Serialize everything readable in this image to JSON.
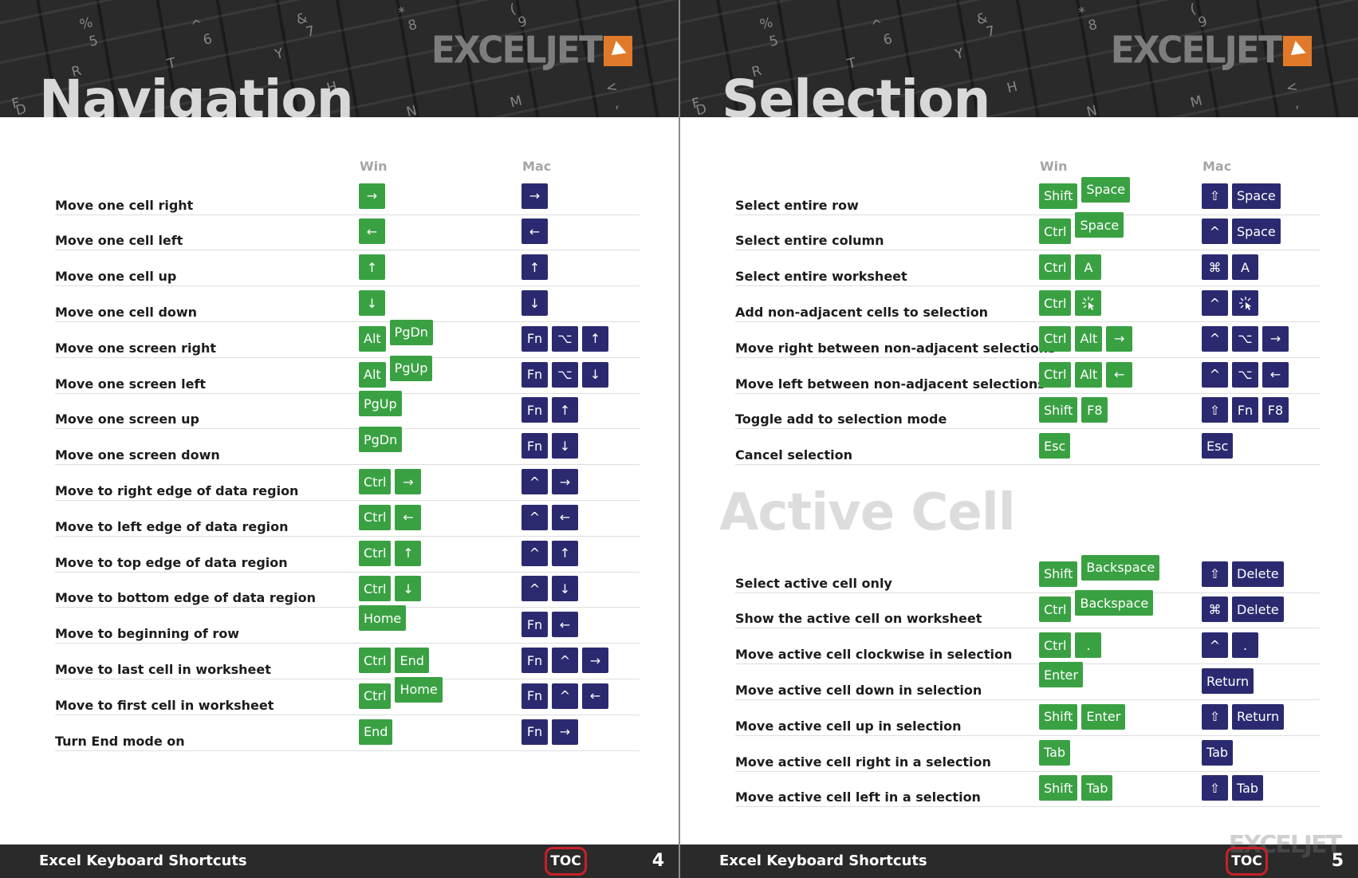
{
  "logo": "EXCELJET",
  "keycaps": [
    "%",
    "5",
    "^",
    "6",
    "&",
    "7",
    "*",
    "8",
    "(",
    "9",
    "T",
    "Y",
    "R",
    "F",
    "H",
    "D",
    "N",
    "M",
    "<",
    ","
  ],
  "columns": {
    "win": "Win",
    "mac": "Mac"
  },
  "left": {
    "title": "Navigation",
    "rows": [
      {
        "label": "Move one cell right",
        "win": [
          "→"
        ],
        "mac": [
          "→"
        ]
      },
      {
        "label": "Move one cell left",
        "win": [
          "←"
        ],
        "mac": [
          "←"
        ]
      },
      {
        "label": "Move one cell up",
        "win": [
          "↑"
        ],
        "mac": [
          "↑"
        ]
      },
      {
        "label": "Move one cell down",
        "win": [
          "↓"
        ],
        "mac": [
          "↓"
        ]
      },
      {
        "label": "Move one screen right",
        "win": [
          "Alt",
          "PgDn"
        ],
        "mac": [
          "Fn",
          "⌥",
          "↑"
        ]
      },
      {
        "label": "Move one screen left",
        "win": [
          "Alt",
          "PgUp"
        ],
        "mac": [
          "Fn",
          "⌥",
          "↓"
        ]
      },
      {
        "label": "Move one screen up",
        "win": [
          "PgUp"
        ],
        "mac": [
          "Fn",
          "↑"
        ]
      },
      {
        "label": "Move one screen down",
        "win": [
          "PgDn"
        ],
        "mac": [
          "Fn",
          "↓"
        ]
      },
      {
        "label": "Move to right edge of data region",
        "win": [
          "Ctrl",
          "→"
        ],
        "mac": [
          "^",
          "→"
        ]
      },
      {
        "label": "Move to left edge of data region",
        "win": [
          "Ctrl",
          "←"
        ],
        "mac": [
          "^",
          "←"
        ]
      },
      {
        "label": "Move to top edge of data region",
        "win": [
          "Ctrl",
          "↑"
        ],
        "mac": [
          "^",
          "↑"
        ]
      },
      {
        "label": "Move to bottom edge of data region",
        "win": [
          "Ctrl",
          "↓"
        ],
        "mac": [
          "^",
          "↓"
        ]
      },
      {
        "label": "Move to beginning of row",
        "win": [
          "Home"
        ],
        "mac": [
          "Fn",
          "←"
        ]
      },
      {
        "label": "Move to last cell in worksheet",
        "win": [
          "Ctrl",
          "End"
        ],
        "mac": [
          "Fn",
          "^",
          "→"
        ]
      },
      {
        "label": "Move to first cell in worksheet",
        "win": [
          "Ctrl",
          "Home"
        ],
        "mac": [
          "Fn",
          "^",
          "←"
        ]
      },
      {
        "label": "Turn End mode on",
        "win": [
          "End"
        ],
        "mac": [
          "Fn",
          "→"
        ]
      }
    ],
    "footer": {
      "title": "Excel Keyboard Shortcuts",
      "toc": "TOC",
      "page": "4"
    }
  },
  "right": {
    "title": "Selection",
    "rows": [
      {
        "label": "Select entire row",
        "win": [
          "Shift",
          "Space"
        ],
        "mac": [
          "⇧",
          "Space"
        ]
      },
      {
        "label": "Select entire column",
        "win": [
          "Ctrl",
          "Space"
        ],
        "mac": [
          "^",
          "Space"
        ]
      },
      {
        "label": "Select entire worksheet",
        "win": [
          "Ctrl",
          "A"
        ],
        "mac": [
          "⌘",
          "A"
        ]
      },
      {
        "label": "Add non-adjacent cells to selection",
        "win": [
          "Ctrl",
          "click"
        ],
        "mac": [
          "^",
          "click"
        ]
      },
      {
        "label": "Move right between non-adjacent selections",
        "win": [
          "Ctrl",
          "Alt",
          "→"
        ],
        "mac": [
          "^",
          "⌥",
          "→"
        ]
      },
      {
        "label": "Move left between non-adjacent selections",
        "win": [
          "Ctrl",
          "Alt",
          "←"
        ],
        "mac": [
          "^",
          "⌥",
          "←"
        ]
      },
      {
        "label": "Toggle add to selection mode",
        "win": [
          "Shift",
          "F8"
        ],
        "mac": [
          "⇧",
          "Fn",
          "F8"
        ]
      },
      {
        "label": "Cancel selection",
        "win": [
          "Esc"
        ],
        "mac": [
          "Esc"
        ]
      }
    ],
    "section2": "Active Cell",
    "rows2": [
      {
        "label": "Select active cell only",
        "win": [
          "Shift",
          "Backspace"
        ],
        "mac": [
          "⇧",
          "Delete"
        ]
      },
      {
        "label": "Show the active cell on worksheet",
        "win": [
          "Ctrl",
          "Backspace"
        ],
        "mac": [
          "⌘",
          "Delete"
        ]
      },
      {
        "label": "Move active cell clockwise in selection",
        "win": [
          "Ctrl",
          "."
        ],
        "mac": [
          "^",
          "."
        ]
      },
      {
        "label": "Move active cell down in selection",
        "win": [
          "Enter"
        ],
        "mac": [
          "Return"
        ]
      },
      {
        "label": "Move active cell up in selection",
        "win": [
          "Shift",
          "Enter"
        ],
        "mac": [
          "⇧",
          "Return"
        ]
      },
      {
        "label": "Move active cell right in a selection",
        "win": [
          "Tab"
        ],
        "mac": [
          "Tab"
        ]
      },
      {
        "label": "Move active cell left in a selection",
        "win": [
          "Shift",
          "Tab"
        ],
        "mac": [
          "⇧",
          "Tab"
        ]
      }
    ],
    "footer": {
      "title": "Excel Keyboard Shortcuts",
      "toc": "TOC",
      "page": "5"
    }
  }
}
